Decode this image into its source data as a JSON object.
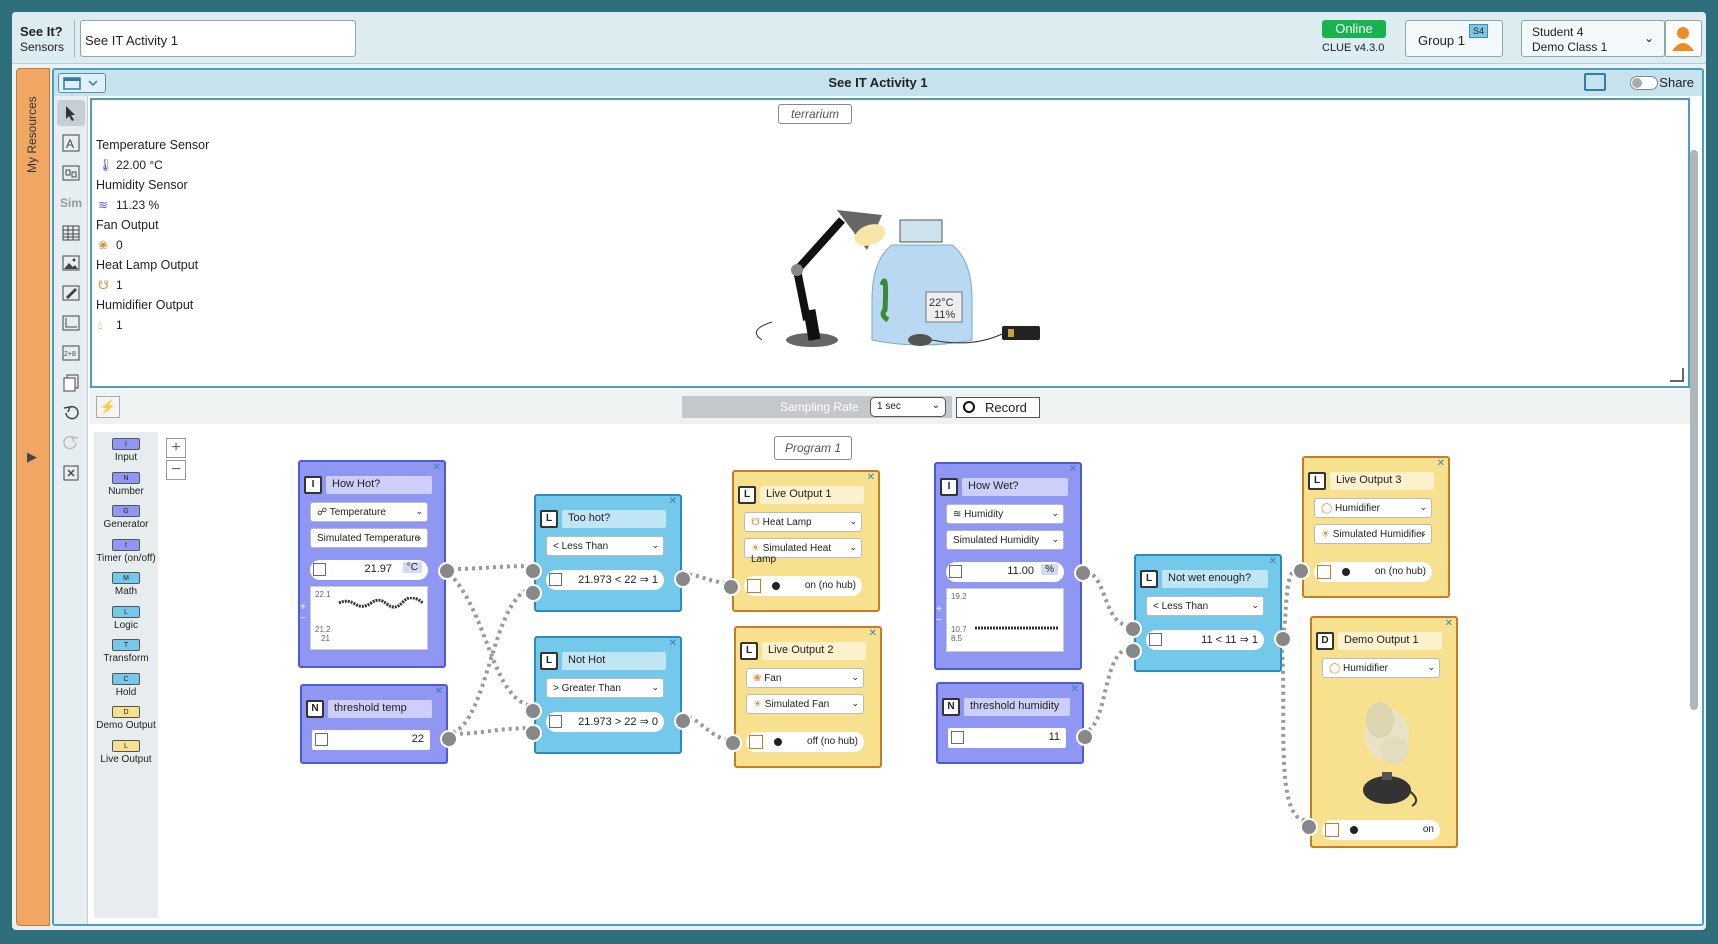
{
  "header": {
    "brand_title": "See It?",
    "brand_subtitle": "Sensors",
    "document_title": "See IT Activity 1",
    "online": "Online",
    "version": "CLUE v4.3.0",
    "group": "Group 1",
    "group_badge": "S4",
    "student_name": "Student 4",
    "class_name": "Demo Class 1"
  },
  "resources": {
    "label": "My Resources"
  },
  "document": {
    "title": "See IT Activity 1",
    "share": "Share"
  },
  "toolbar": {
    "sim": "Sim"
  },
  "terrarium": {
    "label": "terrarium",
    "readout": "22°C\n11%"
  },
  "sensors": [
    {
      "name": "Temperature Sensor",
      "value": "22.00 °C",
      "icon": "thermometer-icon"
    },
    {
      "name": "Humidity Sensor",
      "value": "11.23 %",
      "icon": "humidity-icon"
    },
    {
      "name": "Fan Output",
      "value": "0",
      "icon": "fan-icon"
    },
    {
      "name": "Heat Lamp Output",
      "value": "1",
      "icon": "lamp-icon"
    },
    {
      "name": "Humidifier Output",
      "value": "1",
      "icon": "drop-icon"
    }
  ],
  "controls": {
    "sampling_label": "Sampling Rate",
    "sampling_value": "1 sec",
    "record": "Record"
  },
  "palette": [
    {
      "code": "I",
      "label": "Input",
      "color": "#8f97f2"
    },
    {
      "code": "N",
      "label": "Number",
      "color": "#8f97f2"
    },
    {
      "code": "G",
      "label": "Generator",
      "color": "#8f97f2"
    },
    {
      "code": "t",
      "label": "Timer (on/off)",
      "color": "#8f97f2"
    },
    {
      "code": "M",
      "label": "Math",
      "color": "#74c8ea"
    },
    {
      "code": "L",
      "label": "Logic",
      "color": "#74c8ea"
    },
    {
      "code": "T",
      "label": "Transform",
      "color": "#74c8ea"
    },
    {
      "code": "C",
      "label": "Hold",
      "color": "#74c8ea"
    },
    {
      "code": "D",
      "label": "Demo Output",
      "color": "#f7e08e"
    },
    {
      "code": "L",
      "label": "Live Output",
      "color": "#f7e08e"
    }
  ],
  "program": {
    "label": "Program 1",
    "how_hot": {
      "badge": "I",
      "title": "How Hot?",
      "sensor": "Temperature",
      "source": "Simulated Temperature",
      "value": "21.97",
      "unit": "°C",
      "graph_max": "22.1",
      "graph_mid": "21.2",
      "graph_min": "21"
    },
    "threshold_temp": {
      "badge": "N",
      "title": "threshold temp",
      "value": "22"
    },
    "too_hot": {
      "badge": "L",
      "title": "Too hot?",
      "op": "Less Than",
      "result": "21.973 < 22 ⇒ 1"
    },
    "not_hot": {
      "badge": "L",
      "title": "Not Hot",
      "op": "Greater Than",
      "result": "21.973 > 22 ⇒ 0"
    },
    "live1": {
      "badge": "L",
      "title": "Live Output 1",
      "device": "Heat Lamp",
      "sim": "Simulated Heat Lamp",
      "state": "on (no hub)"
    },
    "live2": {
      "badge": "L",
      "title": "Live Output 2",
      "device": "Fan",
      "sim": "Simulated Fan",
      "state": "off (no hub)"
    },
    "how_wet": {
      "badge": "I",
      "title": "How Wet?",
      "sensor": "Humidity",
      "source": "Simulated Humidity",
      "value": "11.00",
      "unit": "%",
      "graph_max": "19.2",
      "graph_mid": "10.7",
      "graph_min": "8.5"
    },
    "threshold_humidity": {
      "badge": "N",
      "title": "threshold humidity",
      "value": "11"
    },
    "not_wet": {
      "badge": "L",
      "title": "Not wet enough?",
      "op": "Less Than",
      "result": "11 < 11 ⇒ 1"
    },
    "live3": {
      "badge": "L",
      "title": "Live Output 3",
      "device": "Humidifier",
      "sim": "Simulated Humidifier",
      "state": "on (no hub)"
    },
    "demo1": {
      "badge": "D",
      "title": "Demo Output 1",
      "device": "Humidifier",
      "state": "on"
    }
  }
}
